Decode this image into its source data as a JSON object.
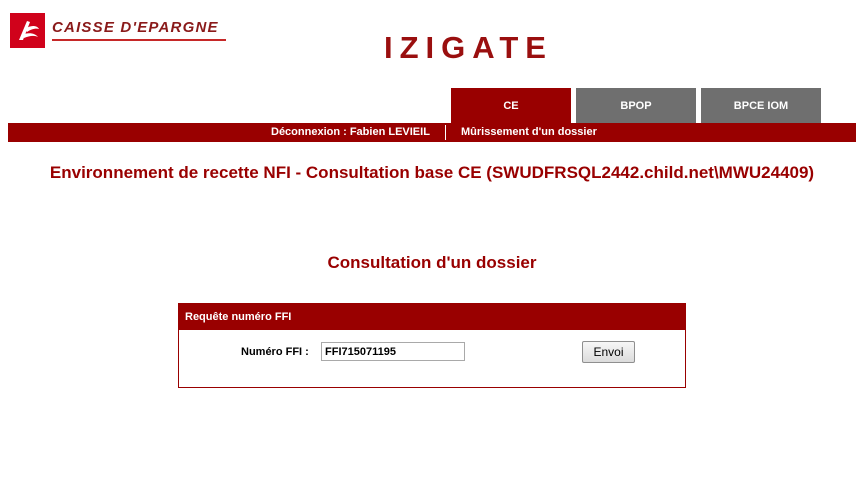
{
  "brand": {
    "logo_icon": "squirrel-logo-icon",
    "logo_text": "CAISSE D'EPARGNE",
    "color": "#c62828"
  },
  "app": {
    "title": "IZIGATE",
    "accent_color": "#990000"
  },
  "tabs": [
    {
      "label": "CE",
      "active": true
    },
    {
      "label": "BPOP",
      "active": false
    },
    {
      "label": "BPCE IOM",
      "active": false
    }
  ],
  "navbar": {
    "logout_label": "Déconnexion : Fabien LEVIEIL",
    "link_label": "Mûrissement d'un dossier"
  },
  "environment_title": "Environnement de recette NFI - Consultation base CE (SWUDFRSQL2442.child.net\\MWU24409)",
  "page_title": "Consultation d'un dossier",
  "form": {
    "header": "Requête numéro FFI",
    "field_label": "Numéro FFI :",
    "field_value": "FFI715071195",
    "submit_label": "Envoi"
  }
}
